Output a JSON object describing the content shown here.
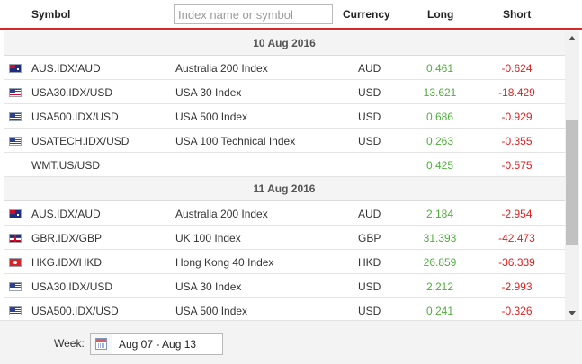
{
  "header": {
    "symbol_label": "Symbol",
    "search_placeholder": "Index name or symbol",
    "currency_label": "Currency",
    "long_label": "Long",
    "short_label": "Short"
  },
  "groups": [
    {
      "date": "10 Aug 2016",
      "rows": [
        {
          "flag": "aud",
          "symbol": "AUS.IDX/AUD",
          "name": "Australia 200 Index",
          "currency": "AUD",
          "long": "0.461",
          "short": "-0.624"
        },
        {
          "flag": "usd",
          "symbol": "USA30.IDX/USD",
          "name": "USA 30 Index",
          "currency": "USD",
          "long": "13.621",
          "short": "-18.429"
        },
        {
          "flag": "usd",
          "symbol": "USA500.IDX/USD",
          "name": "USA 500 Index",
          "currency": "USD",
          "long": "0.686",
          "short": "-0.929"
        },
        {
          "flag": "usd",
          "symbol": "USATECH.IDX/USD",
          "name": "USA 100 Technical Index",
          "currency": "USD",
          "long": "0.263",
          "short": "-0.355"
        },
        {
          "flag": "none",
          "symbol": "WMT.US/USD",
          "name": "",
          "currency": "",
          "long": "0.425",
          "short": "-0.575"
        }
      ]
    },
    {
      "date": "11 Aug 2016",
      "rows": [
        {
          "flag": "aud",
          "symbol": "AUS.IDX/AUD",
          "name": "Australia 200 Index",
          "currency": "AUD",
          "long": "2.184",
          "short": "-2.954"
        },
        {
          "flag": "gbp",
          "symbol": "GBR.IDX/GBP",
          "name": "UK 100 Index",
          "currency": "GBP",
          "long": "31.393",
          "short": "-42.473"
        },
        {
          "flag": "hkd",
          "symbol": "HKG.IDX/HKD",
          "name": "Hong Kong 40 Index",
          "currency": "HKD",
          "long": "26.859",
          "short": "-36.339"
        },
        {
          "flag": "usd",
          "symbol": "USA30.IDX/USD",
          "name": "USA 30 Index",
          "currency": "USD",
          "long": "2.212",
          "short": "-2.993"
        },
        {
          "flag": "usd",
          "symbol": "USA500.IDX/USD",
          "name": "USA 500 Index",
          "currency": "USD",
          "long": "0.241",
          "short": "-0.326"
        }
      ]
    }
  ],
  "footer": {
    "week_label": "Week:",
    "week_value": "Aug 07 - Aug 13"
  },
  "colors": {
    "accent_red": "#d9262b",
    "long_green": "#4fae3a",
    "short_red": "#e02020"
  }
}
